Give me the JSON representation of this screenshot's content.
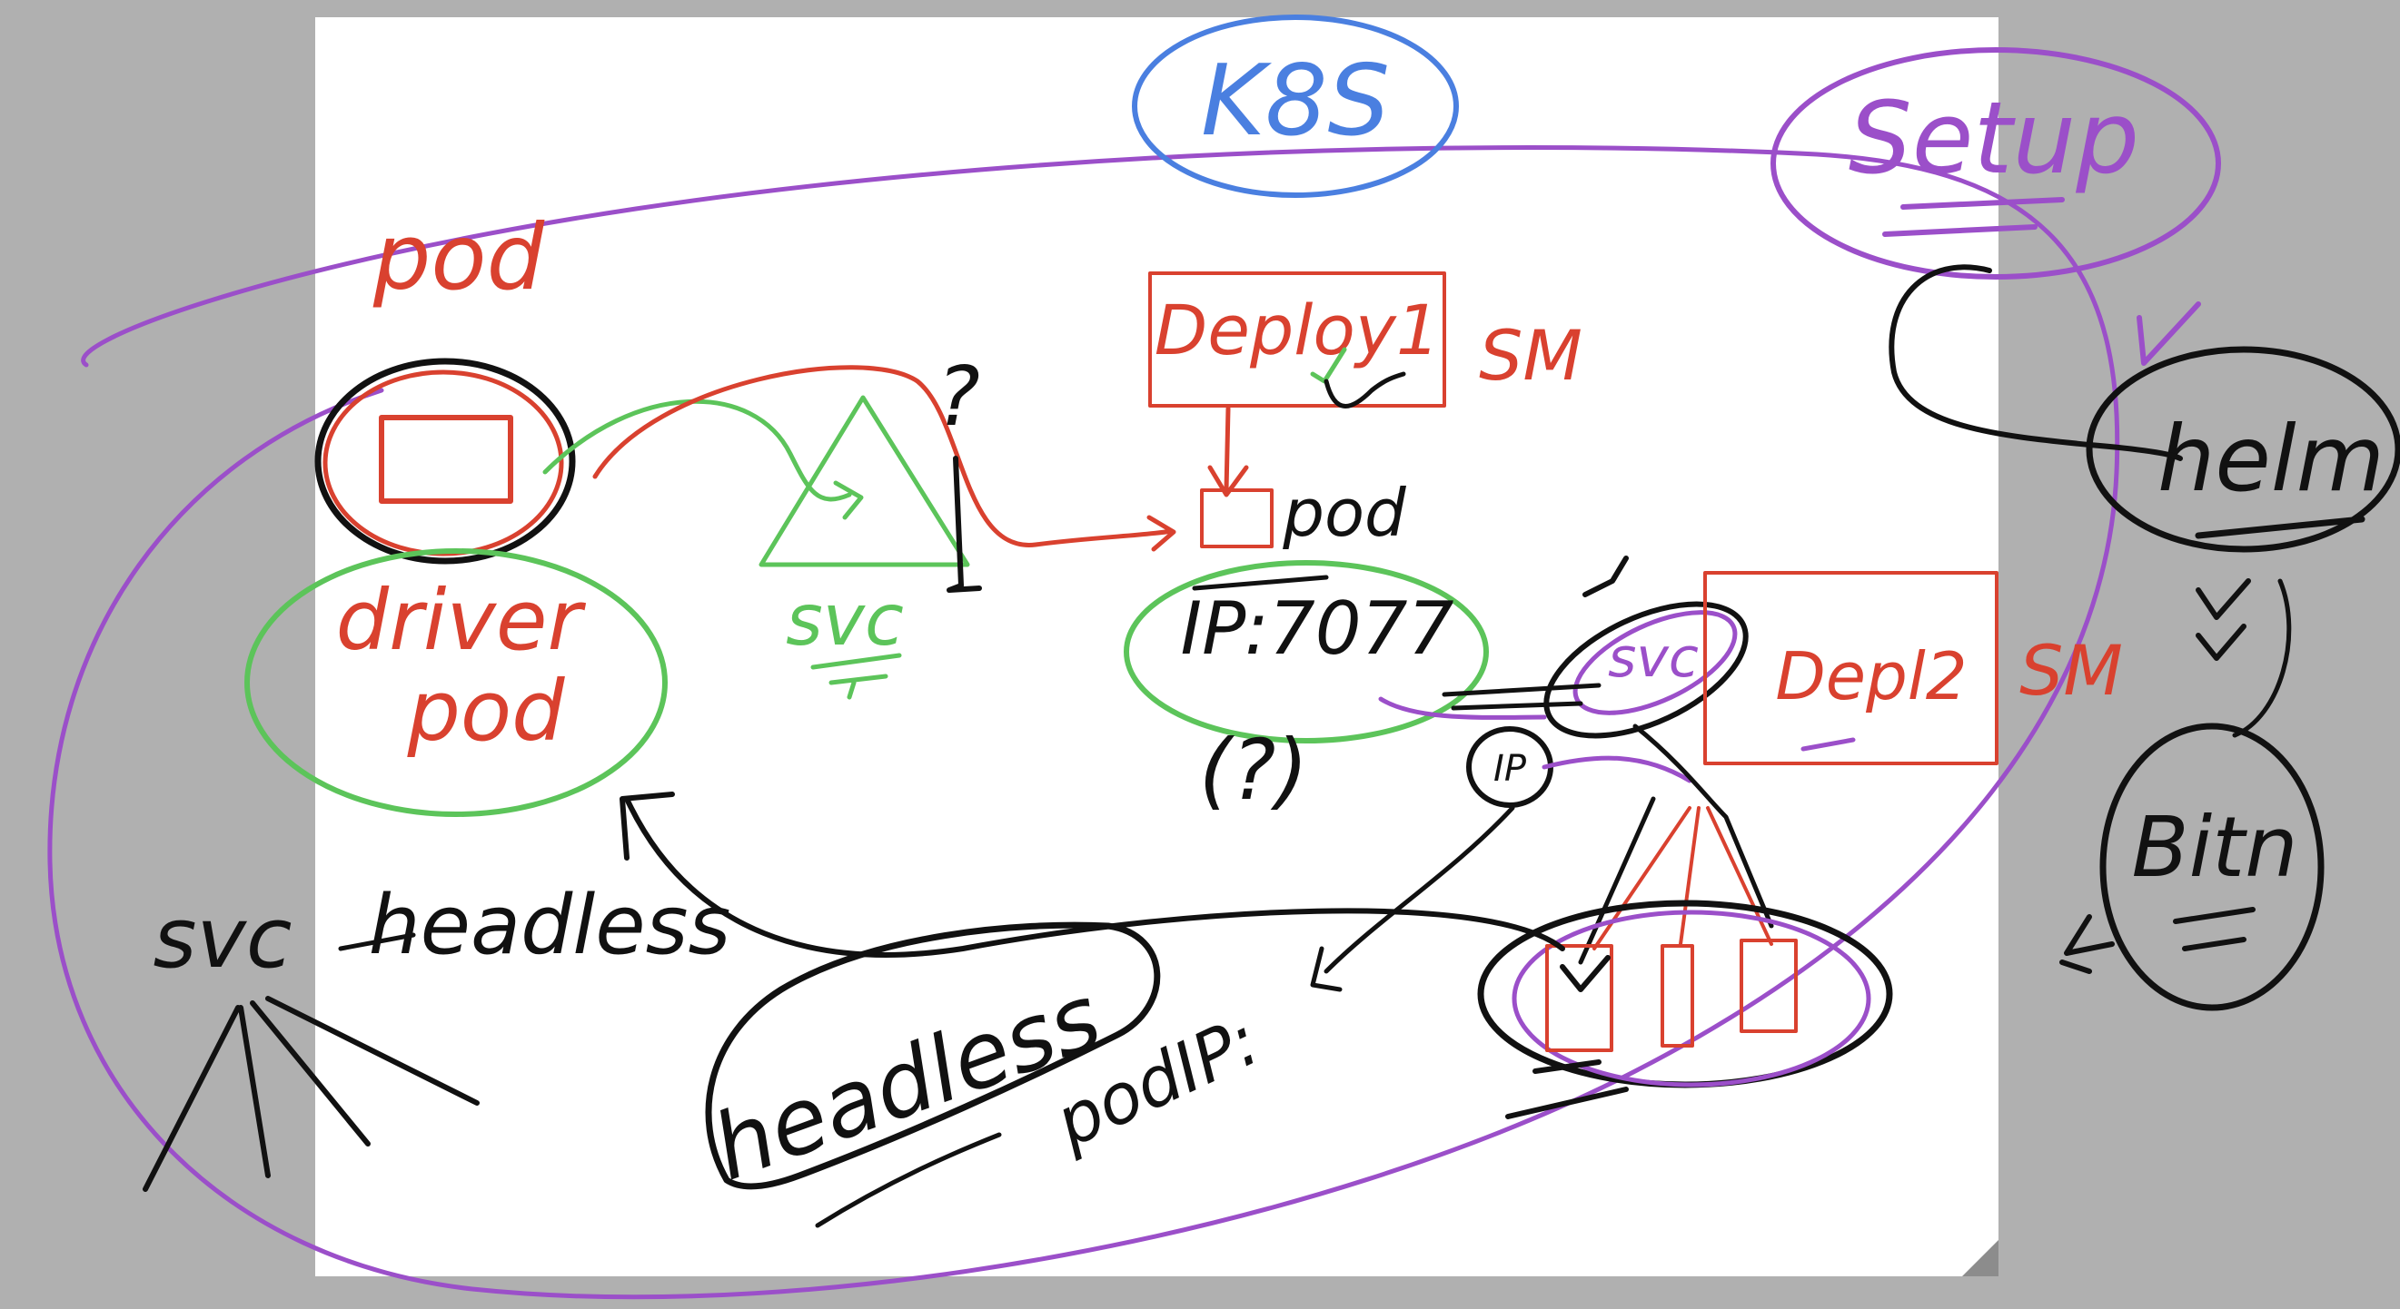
{
  "colors": {
    "background": "#b0b0b0",
    "paper": "#ffffff",
    "black": "#111111",
    "red": "#d9412f",
    "green": "#5cc45a",
    "blue": "#4a7fe0",
    "purple": "#9b4fc9"
  },
  "labels": {
    "k8s": "K8S",
    "setup": "Setup",
    "pod_title": "pod",
    "deploy1": "Deploy1",
    "sm1": "SM",
    "pod_small": "pod",
    "helm": "helm",
    "question_top": "?",
    "svc_green": "svc",
    "driver": "driver",
    "driver_pod": "pod",
    "ip_port": "IP:7077",
    "question_bottom": "(?)",
    "svc_purple": "svc",
    "ip_small": "IP",
    "deploy2": "Depl2",
    "sm2": "SM",
    "bitn": "Bitn",
    "svc_left": "svc",
    "headless_left": "headless",
    "headless_center": "headless",
    "podip": "podIP:"
  }
}
